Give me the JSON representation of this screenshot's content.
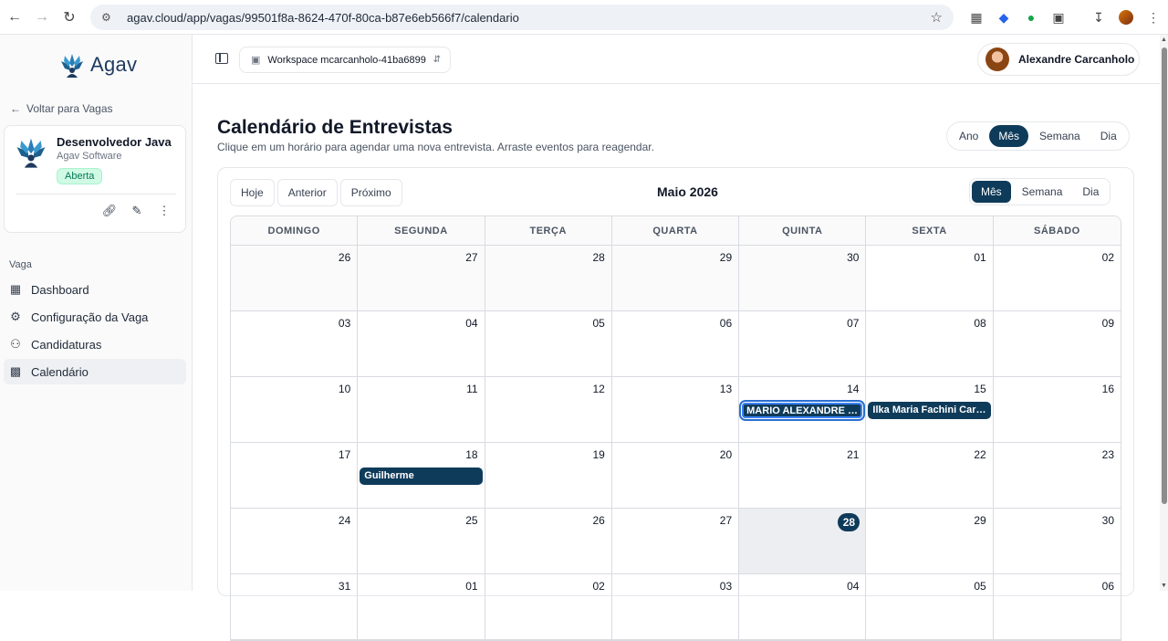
{
  "browser": {
    "url": "agav.cloud/app/vagas/99501f8a-8624-470f-80ca-b87e6eb566f7/calendario",
    "icons": [
      "back-icon",
      "forward-icon",
      "reload-icon",
      "site-info-icon",
      "star-icon",
      "extension-icon",
      "tag-icon",
      "cursor-icon",
      "puzzle-icon",
      "download-icon",
      "profile-icon",
      "menu-icon"
    ]
  },
  "sidebar": {
    "logo_text": "Agav",
    "back_label": "Voltar para Vagas",
    "job": {
      "title": "Desenvolvedor Java",
      "company": "Agav Software",
      "status": "Aberta"
    },
    "section_label": "Vaga",
    "items": [
      {
        "label": "Dashboard",
        "icon": "grid-icon"
      },
      {
        "label": "Configuração da Vaga",
        "icon": "gear-icon"
      },
      {
        "label": "Candidaturas",
        "icon": "users-icon"
      },
      {
        "label": "Calendário",
        "icon": "calendar-icon",
        "active": true
      }
    ]
  },
  "topbar": {
    "workspace": "Workspace mcarcanholo-41ba6899",
    "user_name": "Alexandre Carcanholo"
  },
  "page": {
    "title": "Calendário de Entrevistas",
    "subtitle": "Clique em um horário para agendar uma nova entrevista. Arraste eventos para reagendar.",
    "views_top": [
      "Ano",
      "Mês",
      "Semana",
      "Dia"
    ],
    "views_cal": [
      "Mês",
      "Semana",
      "Dia"
    ],
    "active_view": "Mês"
  },
  "calendar": {
    "nav": [
      "Hoje",
      "Anterior",
      "Próximo"
    ],
    "month_label": "Maio 2026",
    "weekdays": [
      "DOMINGO",
      "SEGUNDA",
      "TERÇA",
      "QUARTA",
      "QUINTA",
      "SEXTA",
      "SÁBADO"
    ],
    "weeks": [
      [
        "26",
        "27",
        "28",
        "29",
        "30",
        "01",
        "02"
      ],
      [
        "03",
        "04",
        "05",
        "06",
        "07",
        "08",
        "09"
      ],
      [
        "10",
        "11",
        "12",
        "13",
        "14",
        "15",
        "16"
      ],
      [
        "17",
        "18",
        "19",
        "20",
        "21",
        "22",
        "23"
      ],
      [
        "24",
        "25",
        "26",
        "27",
        "28",
        "29",
        "30"
      ],
      [
        "31",
        "01",
        "02",
        "03",
        "04",
        "05",
        "06"
      ]
    ],
    "events": [
      {
        "week": 2,
        "day": 4,
        "title": "MARIO ALEXANDRE CA...",
        "selected": true
      },
      {
        "week": 2,
        "day": 5,
        "title": "Ilka Maria Fachini Carca..."
      },
      {
        "week": 3,
        "day": 1,
        "title": "Guilherme"
      }
    ],
    "today": {
      "week": 4,
      "day": 4
    }
  }
}
